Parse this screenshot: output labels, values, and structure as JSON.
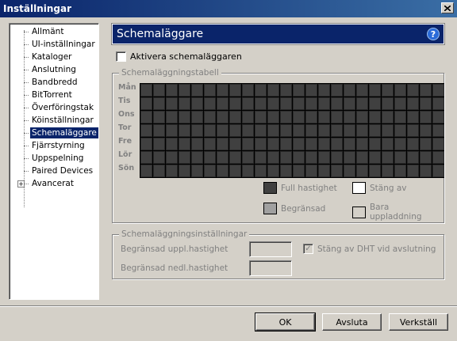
{
  "window": {
    "title": "Inställningar"
  },
  "tree": {
    "items": [
      {
        "label": "Allmänt"
      },
      {
        "label": "UI-inställningar"
      },
      {
        "label": "Kataloger"
      },
      {
        "label": "Anslutning"
      },
      {
        "label": "Bandbredd"
      },
      {
        "label": "BitTorrent"
      },
      {
        "label": "Överföringstak"
      },
      {
        "label": "Köinställningar"
      },
      {
        "label": "Schemaläggare"
      },
      {
        "label": "Fjärrstyrning"
      },
      {
        "label": "Uppspelning"
      },
      {
        "label": "Paired Devices"
      },
      {
        "label": "Avancerat"
      }
    ],
    "selected": "Schemaläggare",
    "expander_symbol": "+"
  },
  "panel": {
    "title": "Schemaläggare",
    "help_symbol": "?"
  },
  "activate": {
    "label": "Aktivera schemaläggaren",
    "checked": false
  },
  "table": {
    "title": "Schemaläggningstabell",
    "days": [
      "Mån",
      "Tis",
      "Ons",
      "Tor",
      "Fre",
      "Lör",
      "Sön"
    ],
    "hours": 24,
    "cell_color": "#404040"
  },
  "legend": {
    "full": "Full hastighet",
    "off": "Stäng av",
    "limited": "Begränsad",
    "upload_only": "Bara uppladdning",
    "colors": {
      "full": "#404040",
      "off": "#ffffff",
      "limited": "#a0a0a0",
      "upload_only": "#d4d0c8"
    }
  },
  "settings": {
    "title": "Schemaläggningsinställningar",
    "upload_label": "Begränsad uppl.hastighet",
    "upload_value": "",
    "download_label": "Begränsad nedl.hastighet",
    "download_value": "",
    "dht_label": "Stäng av DHT vid avslutning",
    "dht_checked": true
  },
  "buttons": {
    "ok": "OK",
    "cancel": "Avsluta",
    "apply": "Verkställ"
  },
  "colors": {
    "accent": "#0a246a",
    "face": "#d4d0c8"
  }
}
